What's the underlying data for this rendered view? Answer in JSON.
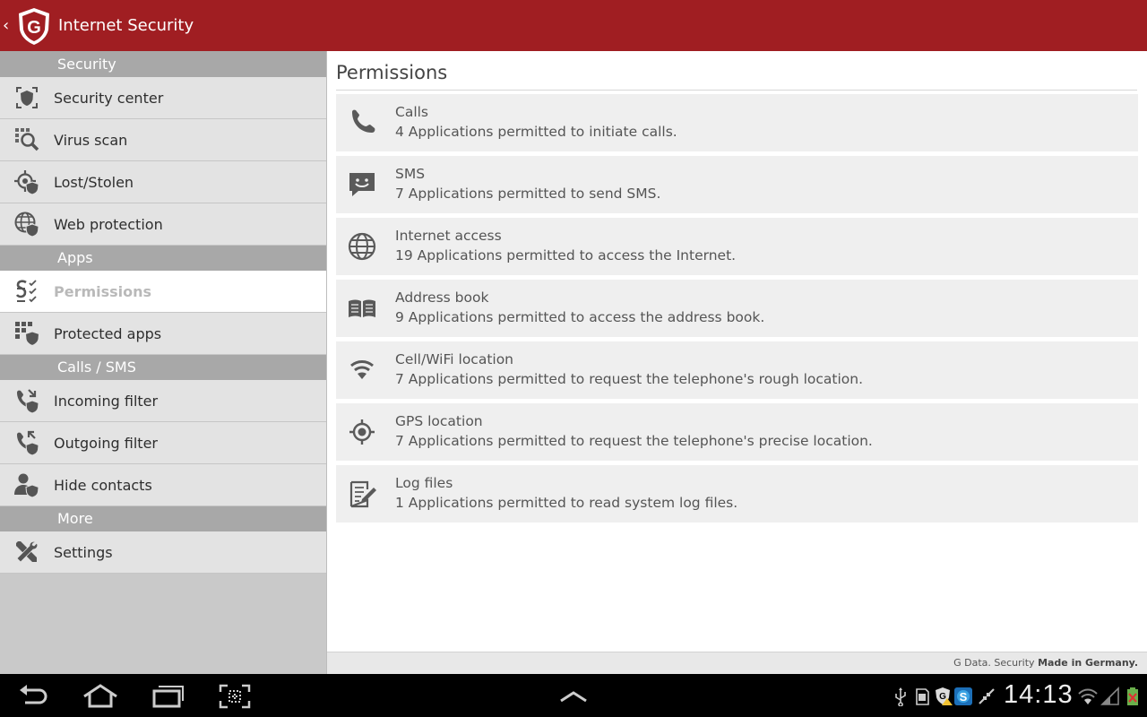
{
  "app": {
    "back_glyph": "‹",
    "title": "Internet Security",
    "brand_color": "#a01e22"
  },
  "sidebar": {
    "sections": [
      {
        "header": "Security",
        "items": [
          {
            "label": "Security center",
            "icon": "shield-scan-icon"
          },
          {
            "label": "Virus scan",
            "icon": "magnify-grid-icon"
          },
          {
            "label": "Lost/Stolen",
            "icon": "locate-shield-icon"
          },
          {
            "label": "Web protection",
            "icon": "globe-shield-icon"
          }
        ]
      },
      {
        "header": "Apps",
        "items": [
          {
            "label": "Permissions",
            "icon": "permissions-icon",
            "active": true
          },
          {
            "label": "Protected apps",
            "icon": "apps-shield-icon"
          }
        ]
      },
      {
        "header": "Calls / SMS",
        "items": [
          {
            "label": "Incoming filter",
            "icon": "incoming-filter-icon"
          },
          {
            "label": "Outgoing filter",
            "icon": "outgoing-filter-icon"
          },
          {
            "label": "Hide contacts",
            "icon": "contact-shield-icon"
          }
        ]
      },
      {
        "header": "More",
        "items": [
          {
            "label": "Settings",
            "icon": "tools-icon"
          }
        ]
      }
    ]
  },
  "main": {
    "title": "Permissions",
    "permissions": [
      {
        "title": "Calls",
        "desc": "4 Applications permitted to initiate calls.",
        "icon": "phone-icon"
      },
      {
        "title": "SMS",
        "desc": "7 Applications permitted to send SMS.",
        "icon": "sms-icon"
      },
      {
        "title": "Internet access",
        "desc": "19 Applications permitted to access the Internet.",
        "icon": "globe-icon"
      },
      {
        "title": "Address book",
        "desc": "9 Applications permitted to access the address book.",
        "icon": "book-icon"
      },
      {
        "title": "Cell/WiFi location",
        "desc": "7 Applications permitted to request the telephone's rough location.",
        "icon": "wifi-icon"
      },
      {
        "title": "GPS location",
        "desc": "7 Applications permitted to request the telephone's precise location.",
        "icon": "gps-icon"
      },
      {
        "title": "Log files",
        "desc": "1 Applications permitted to read system log files.",
        "icon": "log-icon"
      }
    ]
  },
  "footer": {
    "prefix": "G Data. Security",
    "bold": "Made in Germany."
  },
  "systembar": {
    "time": "14:13"
  }
}
